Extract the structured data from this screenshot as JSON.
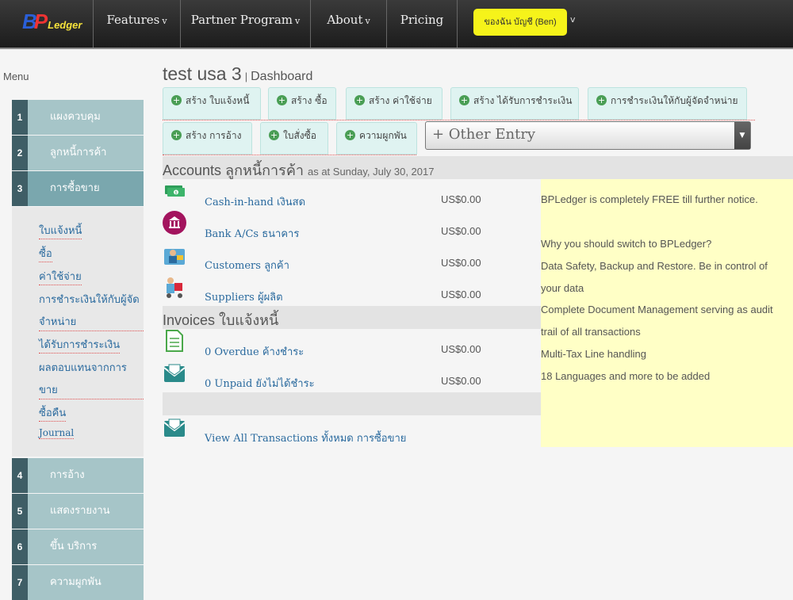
{
  "brand": {
    "logo_b": "B",
    "logo_p": "P",
    "logo_l": "Ledger"
  },
  "nav": {
    "items": [
      {
        "label": "Features",
        "chev": "v"
      },
      {
        "label": "Partner Program",
        "chev": "v"
      },
      {
        "label": "About",
        "chev": "v"
      },
      {
        "label": "Pricing",
        "chev": ""
      }
    ],
    "account_label": "ของฉัน บัญชี (Ben)",
    "account_chev": "v"
  },
  "sidebar": {
    "title": "Menu",
    "items": [
      {
        "num": "1",
        "label": "แผงควบคุม"
      },
      {
        "num": "2",
        "label": "ลูกหนี้การค้า"
      },
      {
        "num": "3",
        "label": "การซื้อขาย"
      },
      {
        "num": "4",
        "label": "การอ้าง"
      },
      {
        "num": "5",
        "label": "แสดงรายงาน"
      },
      {
        "num": "6",
        "label": "ขึ้น บริการ"
      },
      {
        "num": "7",
        "label": "ความผูกพัน"
      }
    ],
    "subitems": [
      "ใบแจ้งหนี้",
      "ซื้อ",
      "ค่าใช้จ่าย",
      "การชำระเงินให้กับผู้จัด",
      "จำหน่าย",
      "ได้รับการชำระเงิน",
      "ผลตอบแทนจากการ",
      "ขาย",
      "ซื้อคืน",
      "Journal"
    ]
  },
  "page": {
    "title": "test usa 3",
    "separator": "|",
    "crumb": "Dashboard"
  },
  "quick": {
    "row1": [
      "สร้าง ใบแจ้งหนี้",
      "สร้าง ซื้อ",
      "สร้าง ค่าใช้จ่าย",
      "สร้าง ได้รับการชำระเงิน",
      "การชำระเงินให้กับผู้จัดจำหน่าย"
    ],
    "row2": [
      "สร้าง การอ้าง",
      "ใบสั่งซื้อ",
      "ความผูกพัน"
    ],
    "plus": "+",
    "other_entry": "+ Other Entry",
    "other_arrow": "▼"
  },
  "accounts": {
    "title": "Accounts ลูกหนี้การค้า",
    "subtitle": "as at Sunday, July 30, 2017",
    "rows": [
      {
        "label": "Cash-in-hand เงินสด",
        "value": "US$0.00"
      },
      {
        "label": "Bank A/Cs ธนาคาร",
        "value": "US$0.00"
      },
      {
        "label": "Customers ลูกค้า",
        "value": "US$0.00"
      },
      {
        "label": "Suppliers ผู้ผลิต",
        "value": "US$0.00"
      }
    ]
  },
  "invoices": {
    "title": "Invoices ใบแจ้งหนี้",
    "rows": [
      {
        "label": "0 Overdue ค้างชำระ",
        "value": "US$0.00"
      },
      {
        "label": "0 Unpaid ยังไม่ได้ชำระ",
        "value": "US$0.00"
      }
    ],
    "view_all": "View All Transactions ทั้งหมด การซื้อขาย"
  },
  "promo": {
    "lines": [
      "BPLedger is completely FREE till further notice.",
      "",
      "Why you should switch to BPLedger?",
      "Data Safety, Backup and Restore. Be in control of",
      "your data",
      "Complete Document Management serving as audit",
      "trail of all transactions",
      "Multi-Tax Line handling",
      "18 Languages and more to be added"
    ]
  },
  "colors": {
    "accent_yellow": "#f6f31a",
    "sidebar_teal": "#a6c5c8",
    "num_dark": "#3f5e66",
    "link_blue": "#2a6a9e",
    "promo_bg": "#ffffc6"
  }
}
